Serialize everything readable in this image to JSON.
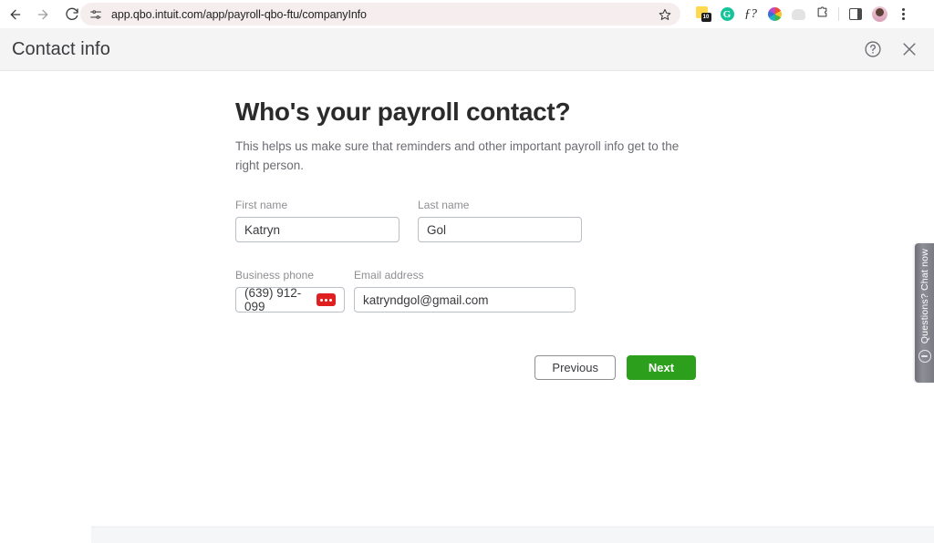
{
  "browser": {
    "back_icon": "arrow-left-icon",
    "forward_icon": "arrow-right-icon",
    "reload_icon": "reload-icon",
    "site_settings_icon": "tune-sliders-icon",
    "url": "app.qbo.intuit.com/app/payroll-qbo-ftu/companyInfo",
    "bookmark_icon": "star-icon",
    "extensions": [
      {
        "name": "notes-extension-icon",
        "badge": "10"
      },
      {
        "name": "grammarly-extension-icon",
        "glyph": "G"
      },
      {
        "name": "math-fx-extension-icon",
        "glyph": "ƒ?"
      },
      {
        "name": "color-wheel-extension-icon"
      },
      {
        "name": "ghost-extension-icon"
      },
      {
        "name": "extensions-puzzle-icon"
      },
      {
        "name": "side-panel-icon"
      },
      {
        "name": "profile-avatar-icon"
      },
      {
        "name": "browser-menu-icon"
      }
    ]
  },
  "header": {
    "title": "Contact info",
    "help_icon": "help-circle-icon",
    "close_icon": "close-x-icon"
  },
  "main": {
    "heading": "Who's your payroll contact?",
    "subheading": "This helps us make sure that reminders and other important payroll info get to the right person.",
    "fields": {
      "first_name": {
        "label": "First name",
        "value": "Katryn",
        "placeholder": ""
      },
      "last_name": {
        "label": "Last name",
        "value": "Gol",
        "placeholder": ""
      },
      "business_phone": {
        "label": "Business phone",
        "value": "(639) 912-099",
        "placeholder": "",
        "redacted": true
      },
      "email": {
        "label": "Email address",
        "value": "katryndgol@gmail.com",
        "placeholder": ""
      }
    },
    "buttons": {
      "previous": "Previous",
      "next": "Next"
    }
  },
  "chat": {
    "label": "Questions? Chat now",
    "icon": "chat-bubble-icon"
  },
  "colors": {
    "brand_green": "#2ca01c",
    "header_bg": "#f4f4f5",
    "omnibox_bg": "#f6eeee",
    "redaction_red": "#e02020",
    "chat_tab_gray": "#8e8e97"
  }
}
